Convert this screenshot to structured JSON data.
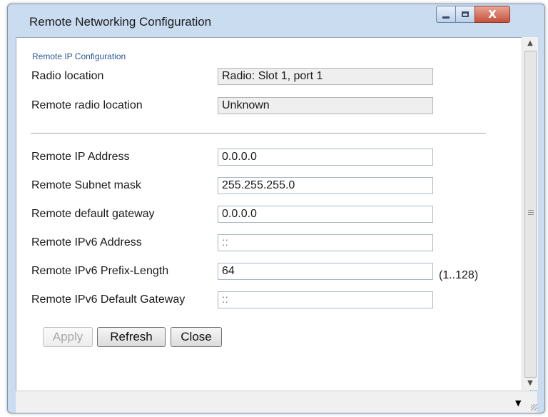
{
  "window": {
    "title": "Remote Networking Configuration",
    "close_glyph": "X"
  },
  "section": {
    "title": "Remote IP Configuration"
  },
  "location": {
    "radio_location_label": "Radio location",
    "radio_location_value": "Radio: Slot 1, port 1",
    "remote_radio_location_label": "Remote radio location",
    "remote_radio_location_value": "Unknown"
  },
  "fields": {
    "remote_ip_label": "Remote IP Address",
    "remote_ip_value": "0.0.0.0",
    "subnet_label": "Remote Subnet mask",
    "subnet_value": "255.255.255.0",
    "gateway_label": "Remote default gateway",
    "gateway_value": "0.0.0.0",
    "ipv6_label": "Remote IPv6 Address",
    "ipv6_value": "::",
    "prefix_label": "Remote IPv6 Prefix-Length",
    "prefix_value": "64",
    "prefix_hint": "(1..128)",
    "ipv6_gateway_label": "Remote IPv6 Default Gateway",
    "ipv6_gateway_value": "::"
  },
  "buttons": {
    "apply": "Apply",
    "refresh": "Refresh",
    "close": "Close"
  },
  "scrollbar": {
    "up_glyph": "▲",
    "down_glyph": "▼"
  },
  "statusbar": {
    "dropdown_glyph": "▼"
  }
}
